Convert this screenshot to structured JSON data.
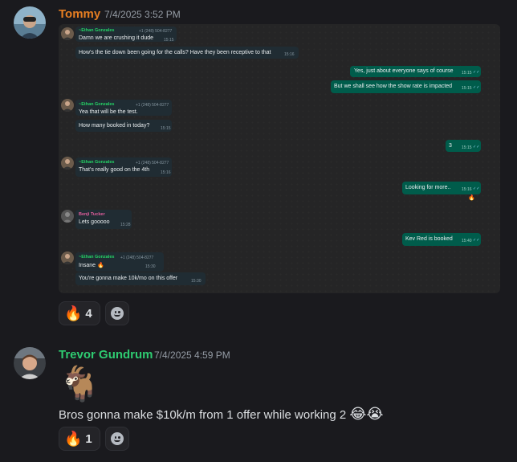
{
  "messages": [
    {
      "author": "Tommy",
      "author_color": "#e67e22",
      "timestamp": "7/4/2025 3:52 PM",
      "attachment": {
        "type": "image",
        "description": "whatsapp-group-chat-screenshot",
        "chat": [
          {
            "dir": "in",
            "sender": "~Ethan Gonzales",
            "sender_color": "#25d366",
            "phone": "+1 (248) 504-8277",
            "lines": [
              "Damn we are crushing it dude",
              "How's the tie down been going for the calls? Have they been receptive to that"
            ],
            "times": [
              "15:15",
              "15:16"
            ]
          },
          {
            "dir": "out",
            "lines": [
              "Yes, just about everyone says of course",
              "But we shall see how the show rate is impacted"
            ],
            "times": [
              "15:15",
              "15:15"
            ]
          },
          {
            "dir": "in",
            "sender": "~Ethan Gonzales",
            "sender_color": "#25d366",
            "phone": "+1 (248) 504-8277",
            "lines": [
              "Yea that will be the test.",
              "How many booked in today?"
            ],
            "times": [
              "",
              "15:15"
            ]
          },
          {
            "dir": "out",
            "lines": [
              "3"
            ],
            "times": [
              "15:15"
            ]
          },
          {
            "dir": "in",
            "sender": "~Ethan Gonzales",
            "sender_color": "#25d366",
            "phone": "+1 (248) 504-8277",
            "lines": [
              "That's really good on the 4th"
            ],
            "times": [
              "15:16"
            ]
          },
          {
            "dir": "out",
            "lines": [
              "Looking for more.."
            ],
            "times": [
              "15:16"
            ],
            "reaction": "🔥"
          },
          {
            "dir": "in",
            "sender": "Benji Tucker",
            "sender_color": "#e35f9e",
            "lines": [
              "Lets gooooo"
            ],
            "times": [
              "15:28"
            ]
          },
          {
            "dir": "out",
            "lines": [
              "Kev Red is booked"
            ],
            "times": [
              "15:40"
            ]
          },
          {
            "dir": "in",
            "sender": "~Ethan Gonzales",
            "sender_color": "#25d366",
            "phone": "+1 (248) 504-8277",
            "lines": [
              "Insane 🔥",
              "You're gonna make 10k/mo on this offer"
            ],
            "times": [
              "15:30",
              "15:30"
            ]
          }
        ]
      },
      "reactions": [
        {
          "emoji": "🔥",
          "count": "4"
        }
      ]
    },
    {
      "author": "Trevor Gundrum",
      "author_color": "#2ecc71",
      "timestamp": "7/4/2025 4:59 PM",
      "big_emoji": "🐐",
      "text": "Bros gonna make $10k/m from 1 offer while working 2",
      "text_emojis": "😂😭",
      "reactions": [
        {
          "emoji": "🔥",
          "count": "1"
        }
      ]
    }
  ]
}
